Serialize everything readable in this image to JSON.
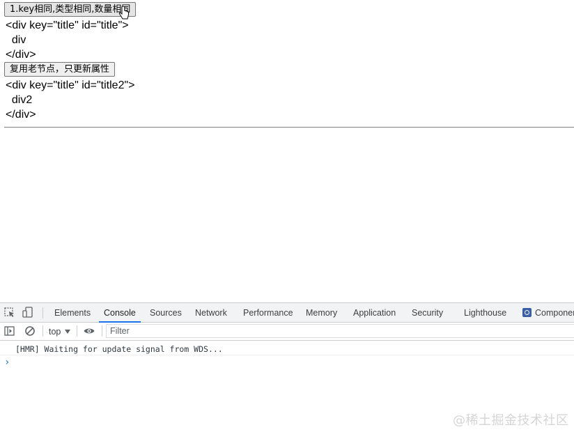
{
  "page": {
    "button1_label": "1.key相同,类型相同,数量相同",
    "block1": [
      "<div key=\"title\" id=\"title\">",
      "  div",
      "</div>"
    ],
    "button2_label": "复用老节点，只更新属性",
    "block2": [
      "<div key=\"title\" id=\"title2\">",
      "  div2",
      "</div>"
    ]
  },
  "devtools": {
    "tabs": [
      "Elements",
      "Console",
      "Sources",
      "Network",
      "Performance",
      "Memory",
      "Application",
      "Security",
      "Lighthouse",
      "Componen"
    ],
    "active_tab": "Console",
    "context": "top",
    "filter_placeholder": "Filter",
    "console_message": "[HMR] Waiting for update signal from WDS...",
    "prompt_symbol": "›",
    "accent_color": "#1a73e8"
  },
  "watermark": "@稀土掘金技术社区"
}
